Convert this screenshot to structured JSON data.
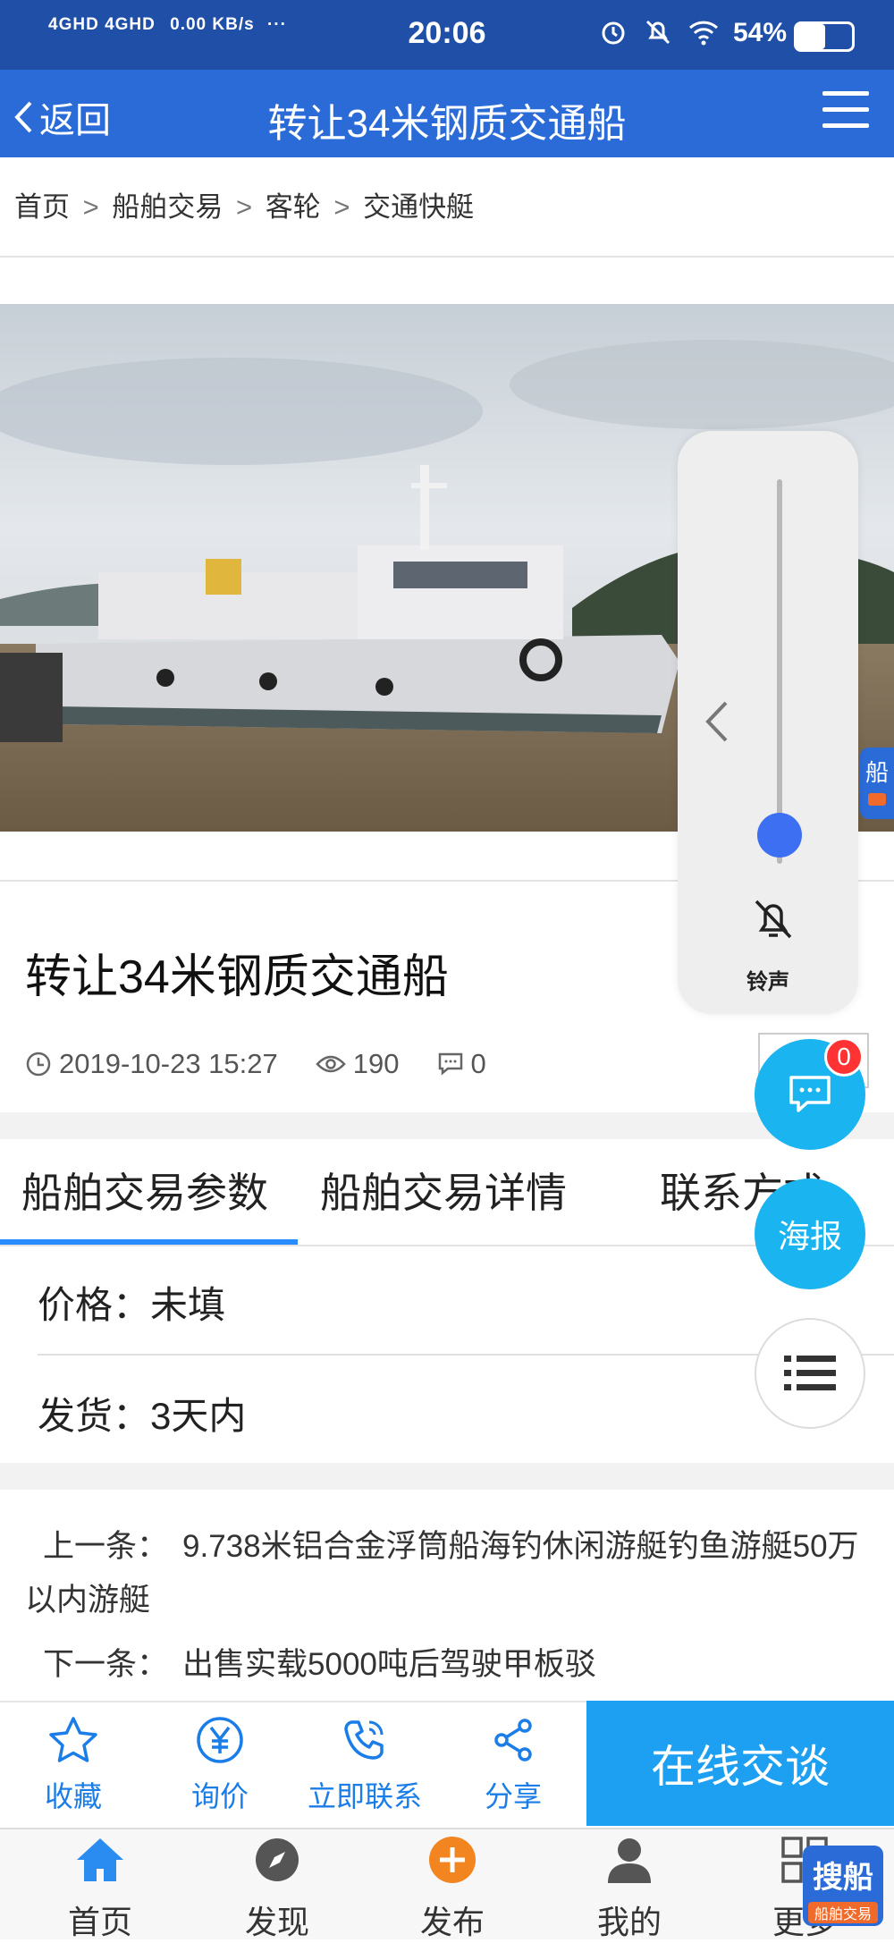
{
  "status_bar": {
    "network": "4GHD 4GHD",
    "speed": "0.00 KB/s",
    "more": "···",
    "time": "20:06",
    "battery": "54%"
  },
  "nav": {
    "back_label": "返回",
    "title": "转让34米钢质交通船"
  },
  "breadcrumb": [
    "首页",
    "船舶交易",
    "客轮",
    "交通快艇"
  ],
  "breadcrumb_sep": ">",
  "post": {
    "title": "转让34米钢质交通船",
    "date": "2019-10-23 15:27",
    "views": "190",
    "comments": "0",
    "share_label": "分享"
  },
  "tabs": [
    "船舶交易参数",
    "船舶交易详情",
    "联系方式"
  ],
  "params": {
    "price_label": "价格：",
    "price_value": "未填",
    "delivery_label": "发货：",
    "delivery_value": "3天内"
  },
  "adjacent": {
    "prev_label": "上一条：",
    "prev_text": "9.738米铝合金浮筒船海钓休闲游艇钓鱼游艇50万以内游艇",
    "next_label": "下一条：",
    "next_text": "出售实载5000吨后驾驶甲板驳"
  },
  "actions": [
    {
      "icon": "star-icon",
      "label": "收藏"
    },
    {
      "icon": "yen-icon",
      "label": "询价"
    },
    {
      "icon": "phone-icon",
      "label": "立即联系"
    },
    {
      "icon": "share-icon",
      "label": "分享"
    }
  ],
  "chat_button": "在线交谈",
  "tabbar": [
    {
      "icon": "home-icon",
      "label": "首页"
    },
    {
      "icon": "compass-icon",
      "label": "发现"
    },
    {
      "icon": "plus-icon",
      "label": "发布"
    },
    {
      "icon": "user-icon",
      "label": "我的"
    },
    {
      "icon": "grid-icon",
      "label": "更多"
    }
  ],
  "floating": {
    "message_badge": "0",
    "poster_label": "海报",
    "side_tag": "船"
  },
  "volume": {
    "ring_label": "铃声",
    "level": 0.05
  },
  "watermark": {
    "main": "搜船",
    "sub": "船舶交易"
  },
  "colors": {
    "nav_bar": "#2a6bd8",
    "status_bar": "#1f4fa6",
    "accent": "#1a7de8",
    "chat_button": "#1da0f2",
    "fab": "#1ab4f0"
  }
}
